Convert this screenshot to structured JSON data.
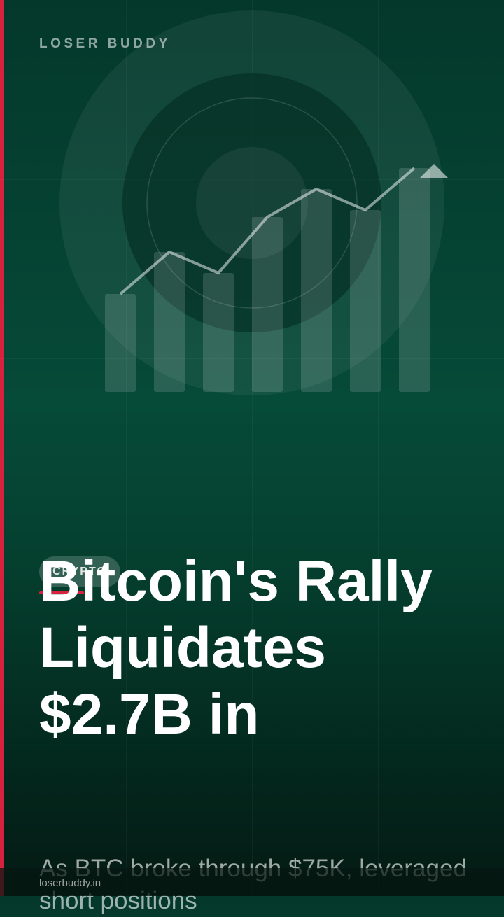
{
  "brand": {
    "name": "LOSER BUDDY"
  },
  "article": {
    "category": "CRYPTO",
    "headline": "Bitcoin's Rally Liquidates $2.7B in",
    "summary": "As BTC broke through $75K, leveraged short positions"
  },
  "footer": {
    "domain": "loserbuddy.in"
  },
  "hero": {
    "icon": "rising-bar-chart-illustration",
    "trend": "up"
  },
  "colors": {
    "accent": "#d6213f",
    "background_top": "#04382b",
    "background_bottom": "#051a14"
  }
}
